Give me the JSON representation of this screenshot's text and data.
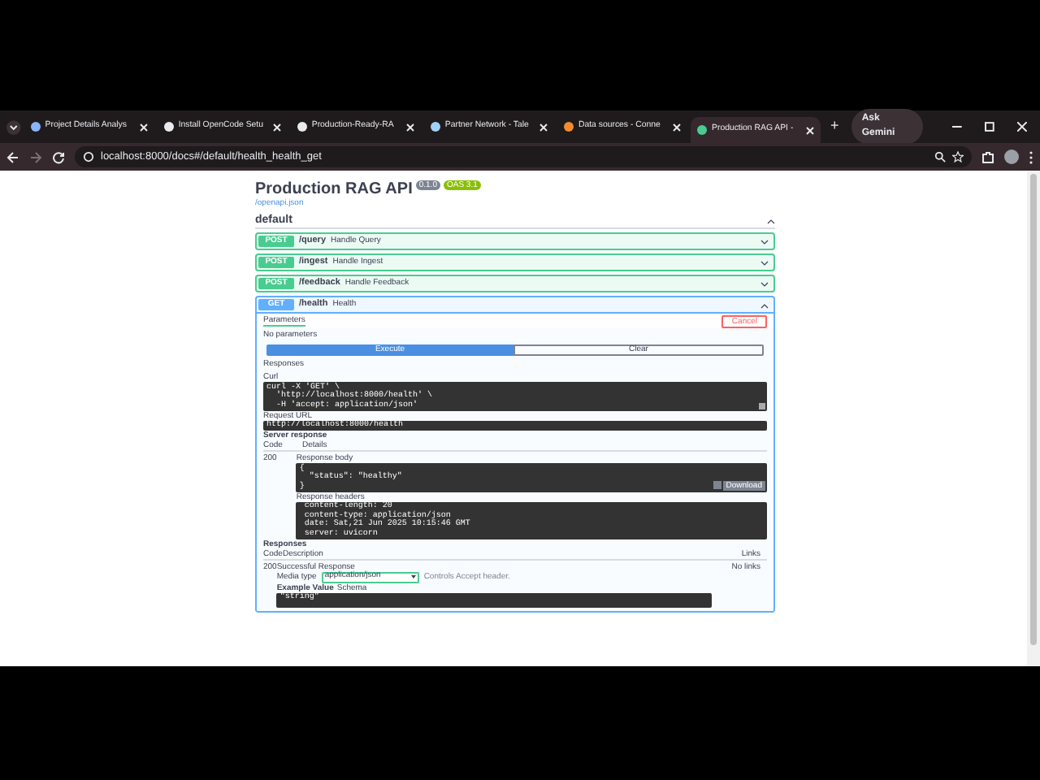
{
  "browser": {
    "tabs": [
      {
        "title": "Project Details Analys",
        "selected": false,
        "color": "#8ab4f8"
      },
      {
        "title": "Install OpenCode Setu",
        "selected": false,
        "color": "#e8eaed"
      },
      {
        "title": "Production-Ready-RA",
        "selected": false,
        "color": "#e8eaed"
      },
      {
        "title": "Partner Network - Tale",
        "selected": false,
        "color": "#9fd3f5"
      },
      {
        "title": "Data sources - Conne",
        "selected": false,
        "color": "#f28b30"
      },
      {
        "title": "Production RAG API -",
        "selected": true,
        "color": "#49cc90"
      }
    ],
    "new_tab": "+",
    "ask_gemini": "Ask Gemini",
    "url": "localhost:8000/docs#/default/health_health_get"
  },
  "page": {
    "title": "Production RAG API",
    "version": "0.1.0",
    "oas": "OAS 3.1",
    "spec_link": "/openapi.json",
    "section": "default",
    "endpoints": [
      {
        "method": "POST",
        "path": "/query",
        "summary": "Handle Query",
        "color": "#49cc90",
        "expanded": false
      },
      {
        "method": "POST",
        "path": "/ingest",
        "summary": "Handle Ingest",
        "color": "#49cc90",
        "expanded": false
      },
      {
        "method": "POST",
        "path": "/feedback",
        "summary": "Handle Feedback",
        "color": "#49cc90",
        "expanded": false
      },
      {
        "method": "GET",
        "path": "/health",
        "summary": "Health",
        "color": "#61affe",
        "expanded": true
      }
    ],
    "detail": {
      "parameters_tab": "Parameters",
      "cancel": "Cancel",
      "no_parameters": "No parameters",
      "execute": "Execute",
      "clear": "Clear",
      "responses_heading": "Responses",
      "curl_label": "Curl",
      "curl": [
        "curl -X 'GET' \\",
        "  'http://localhost:8000/health' \\",
        "  -H 'accept: application/json'"
      ],
      "request_url_label": "Request URL",
      "request_url": "http://localhost:8000/health",
      "server_response": "Server response",
      "code_col": "Code",
      "details_col": "Details",
      "code": "200",
      "body_label": "Response body",
      "body": [
        "{",
        "  \"status\": \"healthy\"",
        "}"
      ],
      "download": "Download",
      "headers_label": "Response headers",
      "headers": [
        " content-length: 20 ",
        " content-type: application/json ",
        " date: Sat,21 Jun 2025 10:15:46 GMT ",
        " server: uvicorn "
      ],
      "responses_label": "Responses",
      "resp_code_col": "Code",
      "description_col": "Description",
      "links_col": "Links",
      "resp_code": "200",
      "resp_description": "Successful Response",
      "no_links": "No links",
      "media_type_label": "Media type",
      "media_type": "application/json",
      "accept_note": "Controls Accept header.",
      "example_value": "Example Value",
      "schema": "Schema",
      "example": "\"string\""
    }
  }
}
